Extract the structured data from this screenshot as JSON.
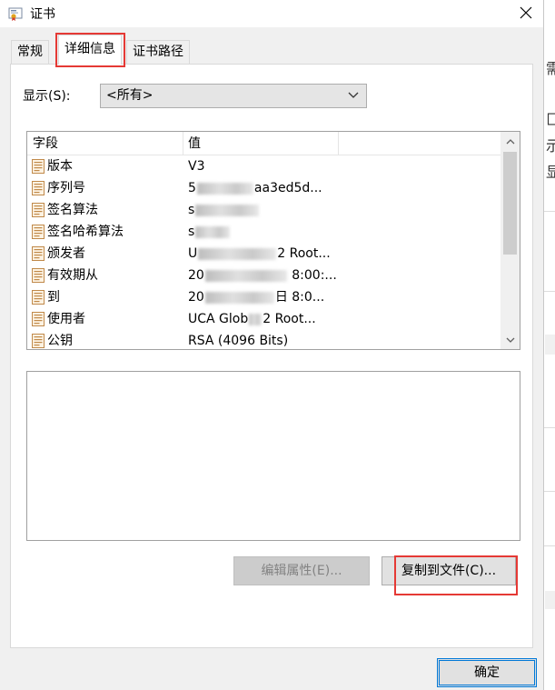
{
  "window": {
    "title": "证书"
  },
  "tabs": [
    {
      "label": "常规"
    },
    {
      "label": "详细信息"
    },
    {
      "label": "证书路径"
    }
  ],
  "show": {
    "label": "显示(S):",
    "selected": "<所有>"
  },
  "list": {
    "headers": {
      "field": "字段",
      "value": "值"
    },
    "rows": [
      {
        "name": "版本",
        "v_pre": "V3",
        "v_post": ""
      },
      {
        "name": "序列号",
        "v_pre": "5",
        "v_post": "aa3ed5d..."
      },
      {
        "name": "签名算法",
        "v_pre": "s",
        "v_post": ""
      },
      {
        "name": "签名哈希算法",
        "v_pre": "s",
        "v_post": ""
      },
      {
        "name": "颁发者",
        "v_pre": "U",
        "v_post": "2 Root..."
      },
      {
        "name": "有效期从",
        "v_pre": "20",
        "v_post": " 8:00:..."
      },
      {
        "name": "到",
        "v_pre": "20",
        "v_post": "日 8:0..."
      },
      {
        "name": "使用者",
        "v_pre": "UCA Glob",
        "v_post": "2 Root..."
      },
      {
        "name": "公钥",
        "v_pre": "RSA (4096 Bits)",
        "v_post": ""
      }
    ]
  },
  "buttons": {
    "edit_properties": "编辑属性(E)...",
    "copy_to_file": "复制到文件(C)...",
    "ok": "确定"
  },
  "background_window": {
    "glyphs": [
      "需",
      "匚",
      "示",
      "显"
    ]
  },
  "colors": {
    "highlight": "#e53935",
    "focus": "#0078d7"
  }
}
